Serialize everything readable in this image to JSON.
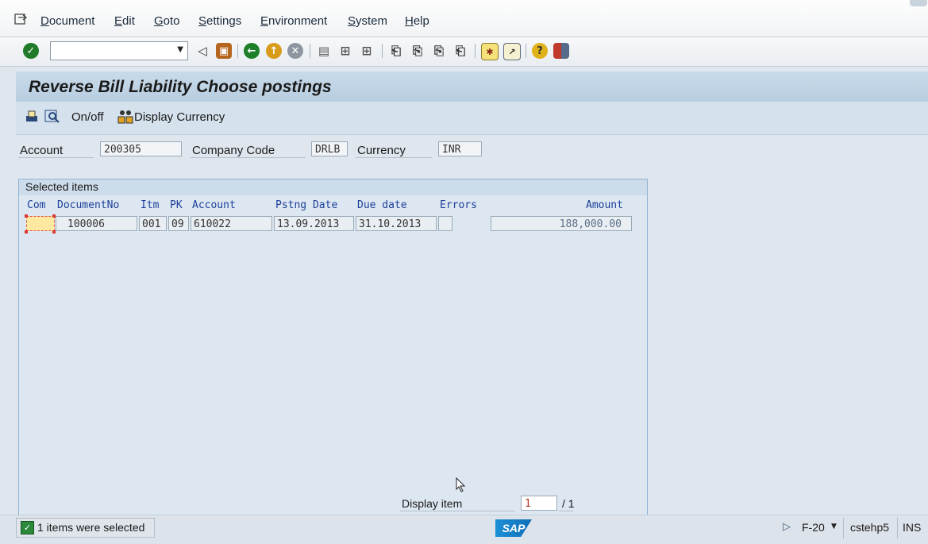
{
  "menu": {
    "items": [
      "Document",
      "Edit",
      "Goto",
      "Settings",
      "Environment",
      "System",
      "Help"
    ]
  },
  "title": "Reverse Bill Liability Choose postings",
  "app_toolbar": {
    "onoff_label": "On/off",
    "display_currency_label": "Display Currency"
  },
  "header_fields": {
    "account_label": "Account",
    "account_value": "200305",
    "company_code_label": "Company Code",
    "company_code_value": "DRLB",
    "currency_label": "Currency",
    "currency_value": "INR"
  },
  "selected_items": {
    "title": "Selected items",
    "columns": [
      "Com",
      "DocumentNo",
      "Itm",
      "PK",
      "Account",
      "Pstng Date",
      "Due date",
      "Errors",
      "Amount"
    ],
    "rows": [
      {
        "com": "",
        "document_no": "100006",
        "itm": "001",
        "pk": "09",
        "account": "610022",
        "posting_date": "13.09.2013",
        "due_date": "31.10.2013",
        "errors": "",
        "amount": "188,000.00"
      }
    ],
    "display_item_label": "Display item",
    "display_item_value": "1",
    "display_item_total": "/ 1"
  },
  "status": {
    "message": "1 items were selected",
    "logo": "SAP",
    "transaction": "F-20",
    "system": "cstehp5",
    "mode": "INS"
  },
  "colors": {
    "accent_blue": "#1d3f99",
    "title_bg": "#c3d7e8",
    "highlight_cell": "#ffe9a0"
  }
}
